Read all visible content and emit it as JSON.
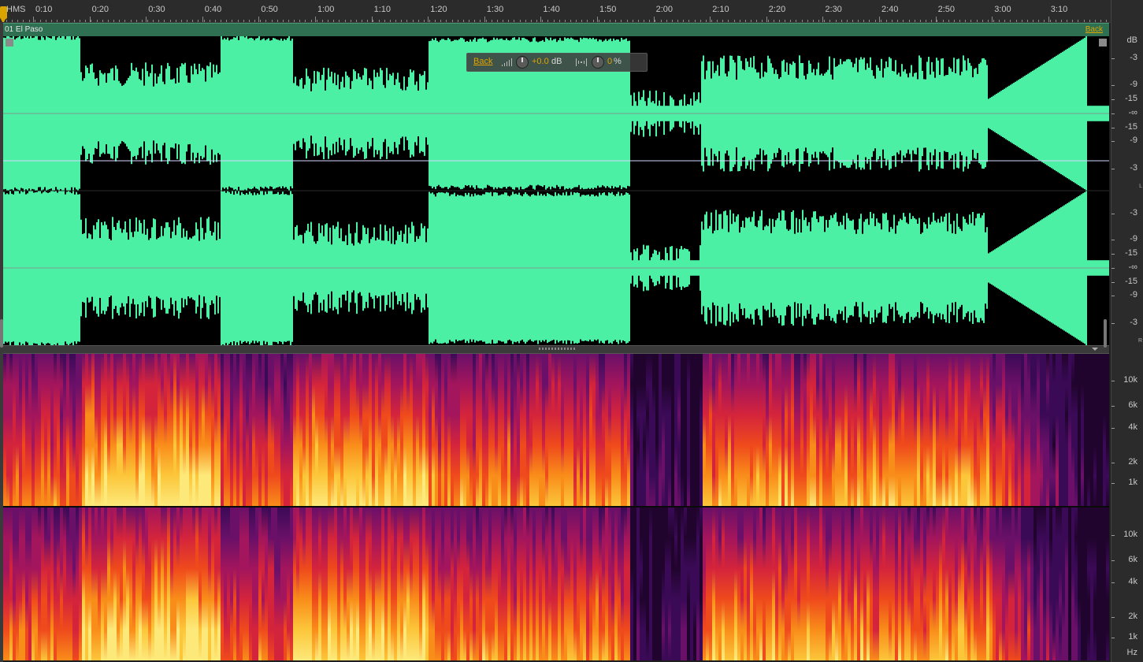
{
  "ruler": {
    "units": "HMS",
    "ticks": [
      "0:10",
      "0:20",
      "0:30",
      "0:40",
      "0:50",
      "1:00",
      "1:10",
      "1:20",
      "1:30",
      "1:40",
      "1:50",
      "2:00",
      "2:10",
      "2:20",
      "2:30",
      "2:40",
      "2:50",
      "3:00",
      "3:10"
    ]
  },
  "clip": {
    "name": "01 El Paso",
    "back_label": "Back"
  },
  "hud": {
    "back_label": "Back",
    "gain_value": "+0.0",
    "gain_unit": "dB",
    "pan_value": "0",
    "pan_unit": "%"
  },
  "amplitude_scale": {
    "unit": "dB",
    "left_channel": [
      "-3",
      "-9",
      "-15",
      "-∞",
      "-15",
      "-9",
      "-3"
    ],
    "right_channel": [
      "-3",
      "-9",
      "-15",
      "-∞",
      "-15",
      "-9",
      "-3"
    ],
    "channel_letters": [
      "L",
      "R"
    ]
  },
  "frequency_scale": {
    "labels": [
      "10k",
      "6k",
      "4k",
      "2k",
      "1k"
    ],
    "unit": "Hz"
  },
  "colors": {
    "waveform": "#4cf0a5",
    "background": "#000000",
    "accent": "#e0a400",
    "clip_header": "#2f6f52"
  }
}
